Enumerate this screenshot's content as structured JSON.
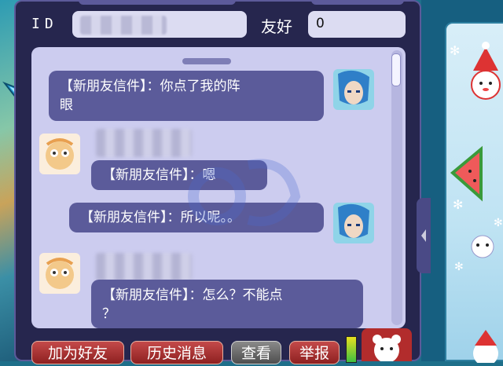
{
  "header": {
    "id_label": "ID",
    "friendship_label": "友好",
    "friendship_value": "0"
  },
  "messages": [
    {
      "side": "right",
      "text": "【新朋友信件】：你点了我的阵\n眼"
    },
    {
      "side": "left",
      "text": "【新朋友信件】：嗯"
    },
    {
      "side": "right",
      "text": "【新朋友信件】：所以呢。。"
    },
    {
      "side": "left",
      "text": "【新朋友信件】：怎么？不能点\n？"
    }
  ],
  "buttons": {
    "add_friend": "加为好友",
    "history": "历史消息",
    "view": "查看",
    "report": "举报"
  },
  "icons": [
    "gem-icon",
    "snowman-icon",
    "watermelon-icon",
    "snowflake-icon",
    "bear-icon",
    "scroll-arrow-icon"
  ],
  "colors": {
    "panel_bg": "#26264e",
    "chat_bg": "#ccccef",
    "bubble": "#5b5b9a",
    "button_red": "#a83030",
    "button_gray": "#6a6a6a"
  }
}
